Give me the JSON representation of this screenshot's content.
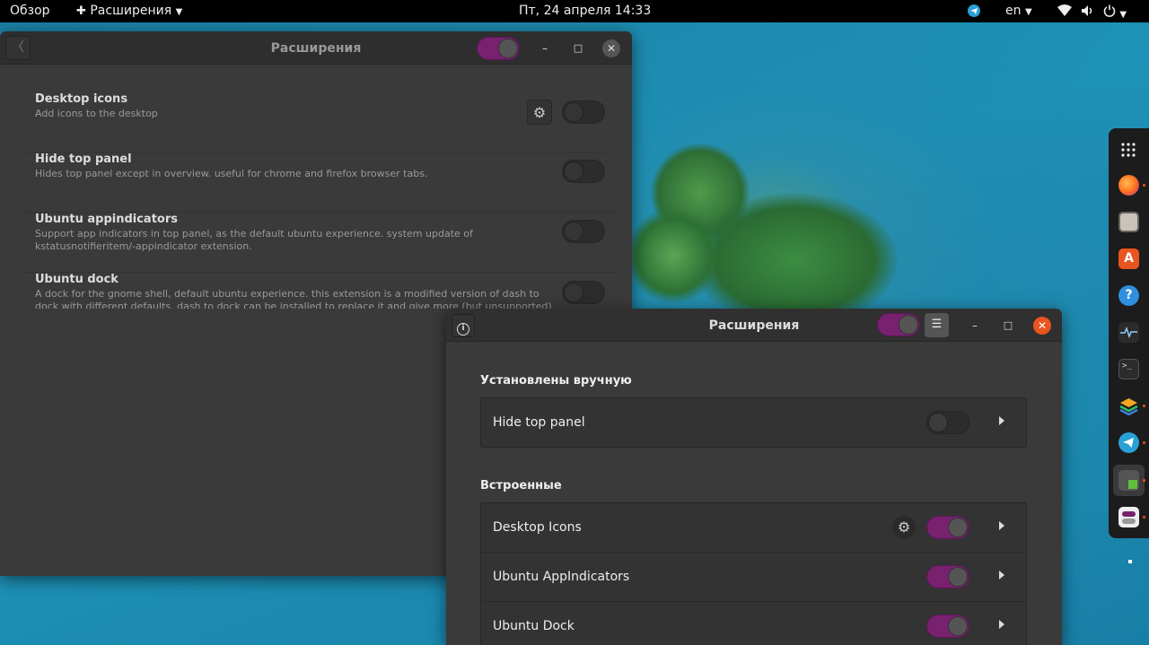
{
  "topbar": {
    "activities": "Обзор",
    "app_menu": "Расширения",
    "clock": "Пт, 24 апреля  14:33",
    "language": "en"
  },
  "dock": {
    "items": [
      "show-apps",
      "firefox",
      "files",
      "software",
      "help",
      "system-monitor",
      "terminal",
      "layers",
      "telegram",
      "extensions",
      "tweaks"
    ]
  },
  "window_legacy": {
    "title": "Расширения",
    "extensions": [
      {
        "name": "Desktop icons",
        "description": "Add icons to the desktop",
        "has_settings": true,
        "enabled": false
      },
      {
        "name": "Hide top panel",
        "description": "Hides top panel except in overview. useful for chrome and firefox browser tabs.",
        "has_settings": false,
        "enabled": false
      },
      {
        "name": "Ubuntu appindicators",
        "description": "Support app indicators in top panel, as the default ubuntu experience. system update of kstatusnotifieritem/-appindicator extension.",
        "has_settings": false,
        "enabled": false
      },
      {
        "name": "Ubuntu dock",
        "description": "A dock for the gnome shell, default ubuntu experience. this extension is a modified version of dash to dock with different defaults. dash to dock can be installed to replace it and give more (but unsupported) configu",
        "has_settings": false,
        "enabled": false
      }
    ],
    "master_enabled": true
  },
  "window_new": {
    "title": "Расширения",
    "master_enabled": true,
    "sections": [
      {
        "title": "Установлены вручную",
        "items": [
          {
            "name": "Hide top panel",
            "enabled": false,
            "has_settings": false
          }
        ]
      },
      {
        "title": "Встроенные",
        "items": [
          {
            "name": "Desktop Icons",
            "enabled": true,
            "has_settings": true
          },
          {
            "name": "Ubuntu AppIndicators",
            "enabled": true,
            "has_settings": false
          },
          {
            "name": "Ubuntu Dock",
            "enabled": true,
            "has_settings": false
          }
        ]
      }
    ]
  },
  "colors": {
    "accent": "#77216f",
    "close_button": "#e95420"
  }
}
